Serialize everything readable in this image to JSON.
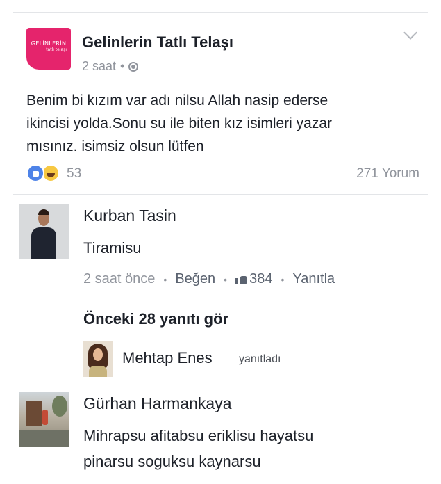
{
  "post": {
    "page_name": "Gelinlerin Tatlı Telaşı",
    "avatar_logo_line1": "GELİNLERİN",
    "avatar_logo_line2": "tatlı telaşı",
    "time": "2 saat",
    "meta_separator": "•",
    "privacy_icon": "globe-icon",
    "options_icon": "chevron-down-icon",
    "text_lines": [
      "Benim bi kızım var adı nilsu Allah nasip ederse",
      "ikincisi yolda.Sonu su ile biten kız isimleri yazar",
      "mısınız. isimsiz olsun lütfen"
    ],
    "reaction_icons": [
      "like-reaction-icon",
      "haha-reaction-icon"
    ],
    "reaction_count": "53",
    "comment_count": "271 Yorum"
  },
  "comments": [
    {
      "author": "Kurban Tasin",
      "text_lines": [
        "Tiramisu"
      ],
      "time": "2 saat önce",
      "like_label": "Beğen",
      "like_count": "384",
      "reply_label": "Yanıtla",
      "separator": "•"
    },
    {
      "author": "Gürhan Harmankaya",
      "text_lines": [
        "Mihrapsu afitabsu eriklisu hayatsu",
        "pinarsu soguksu kaynarsu"
      ]
    }
  ],
  "replies": {
    "view_previous_label": "Önceki 28 yanıtı gör",
    "preview_author": "Mehtap Enes",
    "preview_verb": "yanıtladı"
  },
  "colors": {
    "brand_pink": "#e5246c",
    "like_blue": "#4e83e8",
    "haha_yellow": "#f7c842",
    "meta_gray": "#90949c",
    "text_dark": "#1d2129"
  }
}
